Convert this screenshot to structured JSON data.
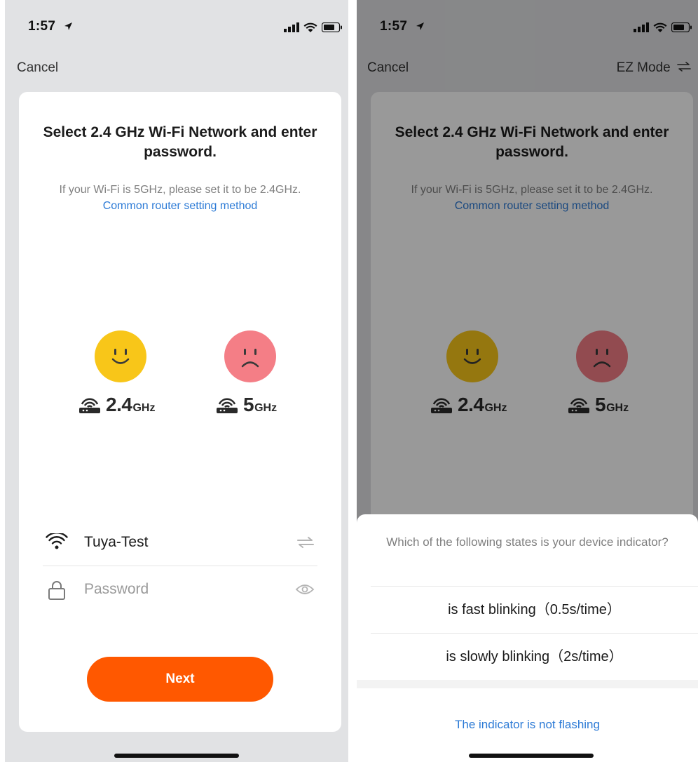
{
  "status_bar": {
    "time": "1:57"
  },
  "left": {
    "nav": {
      "cancel": "Cancel"
    },
    "card": {
      "title": "Select 2.4 GHz Wi-Fi Network and enter password.",
      "hint_text": "If your Wi-Fi is 5GHz, please set it to be 2.4GHz.",
      "hint_link": "Common router setting method",
      "band_good": {
        "value": "2.4",
        "unit": "GHz"
      },
      "band_bad": {
        "value": "5",
        "unit": "GHz"
      },
      "ssid": "Tuya-Test",
      "password_placeholder": "Password",
      "next_label": "Next"
    }
  },
  "right": {
    "nav": {
      "cancel": "Cancel",
      "mode": "EZ Mode"
    },
    "sheet": {
      "question": "Which of the following states is your device indicator?",
      "options": [
        "is fast blinking（0.5s/time）",
        "is slowly blinking（2s/time）"
      ],
      "not_flashing": "The indicator is not flashing"
    }
  },
  "colors": {
    "accent": "#ff5800",
    "link": "#2d7bd6",
    "good_face": "#f8c619",
    "bad_face": "#f47e86"
  },
  "icons": [
    "location-arrow-icon",
    "signal-icon",
    "wifi-icon",
    "battery-icon",
    "swap-icon",
    "router-icon",
    "lock-icon",
    "eye-icon"
  ]
}
